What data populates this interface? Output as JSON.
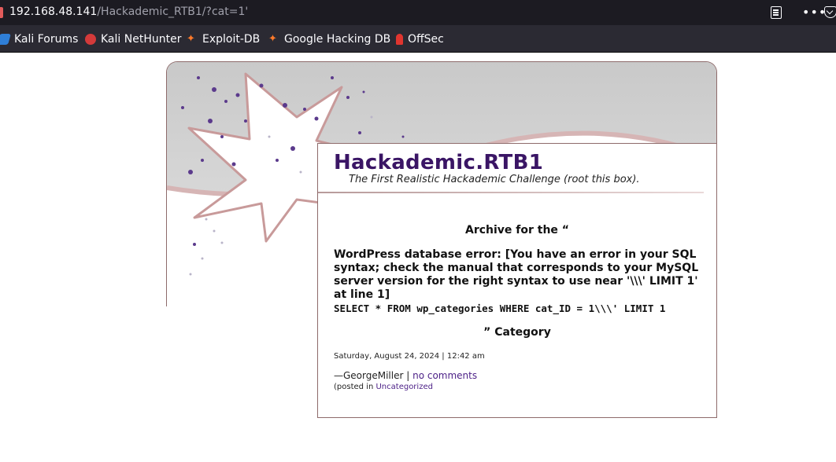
{
  "browser": {
    "url_host": "192.168.48.141",
    "url_path": "/Hackademic_RTB1/?cat=1'",
    "icons": [
      "reader-view-icon",
      "more-icon",
      "pocket-icon"
    ]
  },
  "bookmarks": [
    {
      "label": "Kali Forums",
      "icon": "kali-icon"
    },
    {
      "label": "Kali NetHunter",
      "icon": "nethunter-icon"
    },
    {
      "label": "Exploit-DB",
      "icon": "exploit-db-icon"
    },
    {
      "label": "Google Hacking DB",
      "icon": "ghdb-icon"
    },
    {
      "label": "OffSec",
      "icon": "offsec-icon"
    }
  ],
  "site": {
    "title": "Hackademic.RTB1",
    "tagline": "The First Realistic Hackademic Challenge (root this box)."
  },
  "archive": {
    "heading": "Archive for the “",
    "error": "WordPress database error: [You have an error in your SQL syntax; check the manual that corresponds to your MySQL server version for the right syntax to use near '\\\\\\' LIMIT 1' at line 1]",
    "query": "SELECT * FROM wp_categories WHERE cat_ID = 1\\\\\\' LIMIT 1",
    "category_suffix": "” Category"
  },
  "post": {
    "date": "Saturday, August 24, 2024 | 12:42 am",
    "author_prefix": "—GeorgeMiller | ",
    "comments_link": "no comments",
    "posted_prefix": "(posted in ",
    "category_link": "Uncategorized"
  },
  "colors": {
    "title": "#3a1565",
    "link": "#4b1f86",
    "border": "#8e6b6b"
  }
}
